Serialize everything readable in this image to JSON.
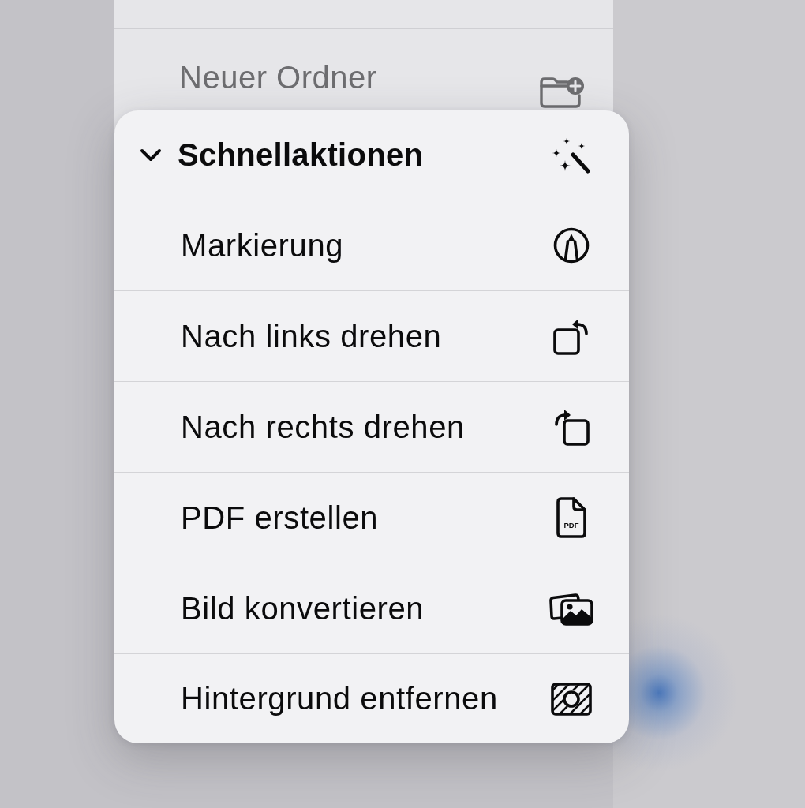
{
  "background_menu": {
    "items": [
      {
        "label": "Neuer Ordner",
        "kind": "new-folder"
      }
    ]
  },
  "quick_actions": {
    "title": "Schnellaktionen",
    "expanded": true,
    "items": [
      {
        "label": "Markierung",
        "kind": "markup"
      },
      {
        "label": "Nach links drehen",
        "kind": "rotate-left"
      },
      {
        "label": "Nach rechts drehen",
        "kind": "rotate-right"
      },
      {
        "label": "PDF erstellen",
        "kind": "pdf",
        "icon_text": "PDF"
      },
      {
        "label": "Bild konvertieren",
        "kind": "convert-image"
      },
      {
        "label": "Hintergrund entfernen",
        "kind": "remove-background"
      }
    ]
  }
}
